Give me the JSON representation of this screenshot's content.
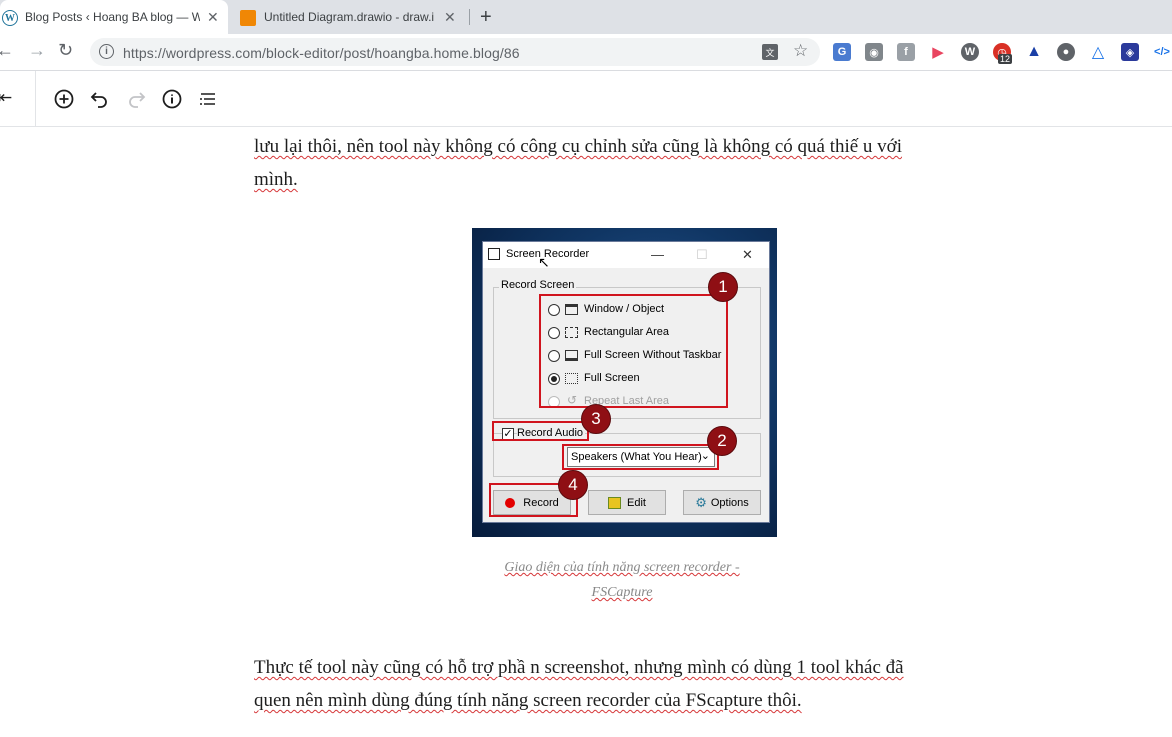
{
  "browser": {
    "tabs": [
      {
        "title": "Blog Posts ‹ Hoang BA blog — W",
        "favicon": "wordpress-icon",
        "active": true
      },
      {
        "title": "Untitled Diagram.drawio - draw.i",
        "favicon": "drawio-icon",
        "active": false
      }
    ],
    "new_tab_label": "+",
    "url": "https://wordpress.com/block-editor/post/hoangba.home.blog/86",
    "extension_badge": "12"
  },
  "editor": {
    "paragraph1_line1": "lưu lại thôi, nên tool này không có công cụ chỉnh sửa cũng là không có quá thiế u với",
    "paragraph1_line2": "mình.",
    "caption_line1": "Giao diện của tính năng screen recorder -",
    "caption_line2": "FSCapture",
    "paragraph2_line1": "Thực tế  tool này cũng có hỗ trợ phầ n screenshot, nhưng mình có dùng 1 tool khác đã",
    "paragraph2_line2": "quen nên mình dùng đúng tính năng screen recorder của FScapture thôi."
  },
  "recorder": {
    "title": "Screen Recorder",
    "group_label": "Record Screen",
    "options": [
      {
        "label": "Window / Object",
        "selected": false,
        "disabled": false
      },
      {
        "label": "Rectangular Area",
        "selected": false,
        "disabled": false
      },
      {
        "label": "Full Screen Without Taskbar",
        "selected": false,
        "disabled": false
      },
      {
        "label": "Full Screen",
        "selected": true,
        "disabled": false
      },
      {
        "label": "Repeat Last Area",
        "selected": false,
        "disabled": true
      }
    ],
    "record_audio_label": "Record Audio",
    "record_audio_checked": true,
    "audio_source": "Speakers (What You Hear)",
    "buttons": {
      "record": "Record",
      "edit": "Edit",
      "options": "Options"
    },
    "badges": [
      "1",
      "2",
      "3",
      "4"
    ]
  },
  "colors": {
    "annotation_red": "#d0141e",
    "badge_fill": "#8f0f14",
    "record_dot": "#e30000"
  }
}
